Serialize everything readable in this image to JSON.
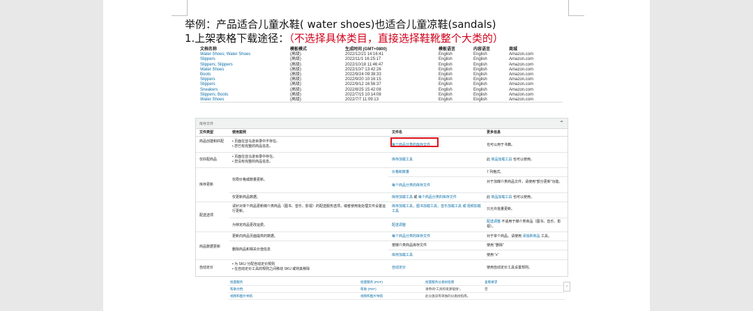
{
  "heading": {
    "line1": "举例：产品适合儿童水鞋( water shoes)也适合儿童凉鞋(sandals)",
    "line2_prefix": "1.上架表格下载途径：",
    "line2_note": "（不选择具体类目，直接选择鞋靴整个大类的）"
  },
  "downloads": {
    "headers": [
      "文档名称",
      "模板模式",
      "生成时间 (GMT+0800)",
      "模板语言",
      "内容语言",
      "商城"
    ],
    "rows": [
      [
        "Water Shoes; Water Shoes",
        "(高级)",
        "2022/12/21 14:16:41",
        "English",
        "English",
        "Amazon.com"
      ],
      [
        "Slippers",
        "(高级)",
        "2022/11/1 16:25:17",
        "English",
        "English",
        "Amazon.com"
      ],
      [
        "Slippers; Slippers",
        "(高级)",
        "2022/10/18 11:46:47",
        "English",
        "English",
        "Amazon.com"
      ],
      [
        "Water Shoes",
        "(高级)",
        "2022/10/7 13:42:26",
        "English",
        "English",
        "Amazon.com"
      ],
      [
        "Boots",
        "(高级)",
        "2022/9/24 09:38:33",
        "English",
        "English",
        "Amazon.com"
      ],
      [
        "Slippers",
        "(高级)",
        "2022/9/20 10:16:15",
        "English",
        "English",
        "Amazon.com"
      ],
      [
        "Slippers",
        "(高级)",
        "2022/9/12 16:56:37",
        "English",
        "English",
        "Amazon.com"
      ],
      [
        "Sneakers",
        "(高级)",
        "2022/8/25 15:42:08",
        "English",
        "English",
        "Amazon.com"
      ],
      [
        "Slippers; Boots",
        "(高级)",
        "2022/7/15 10:14:08",
        "English",
        "English",
        "Amazon.com"
      ],
      [
        "Water Shoes",
        "(高级)",
        "2022/7/7 11:09:13",
        "English",
        "English",
        "Amazon.com"
      ]
    ]
  },
  "usage": {
    "band_title": "库存文件",
    "headers": [
      "文件类型",
      "使用案例",
      "文件名",
      "更多信息"
    ],
    "c_create": "商品创建和匹配",
    "c_create_u1": "• 页面在亚马逊目录中不存在。",
    "c_create_u2": "• 您已有完整的商品信息。",
    "c_create_f": "每个商品分类的库存文件",
    "c_create_i": "也可以用于书籍。",
    "c_match": "仅匹配商品",
    "c_match_u1": "• 页面在亚马逊目录中存在。",
    "c_match_u2": "• 您没有完整的商品信息。",
    "c_match_f": "库存加载工具",
    "c_match_i_pre": "此",
    "c_match_i_link": "商品加载工具",
    "c_match_i_post": "也可以使用。",
    "c_inv": "库存更新",
    "c_inv_f1": "价格和数量",
    "c_inv_i1": "7 列格式。",
    "c_inv_u1": "仅限价格或数量更新。",
    "c_inv_f2": "每个商品分类的库存文件",
    "c_inv_i2": "对于加媒介类商品文件，请使用“部分更新”功能。",
    "c_inv_u3": "仅更新商品数据。",
    "c_inv_f3a": "库存加载工具",
    "c_inv_f3b": "或",
    "c_inv_f3c": "每个商品分类的库存文件",
    "c_inv_i3_pre": "此",
    "c_inv_i3_link": "商品加载工具",
    "c_inv_i3_post": "也可以使用。",
    "c_ship": "配送选项",
    "c_ship_u1": "请针对单个商品更新媒介类商品（图书、音乐、影视）的配送服务选项，或者使用批处理文件设置运行更新。",
    "c_ship_f1a": "库存加载工具",
    "c_ship_f1b": "，图书加载工具，音乐加载工具 或 视频加载工具",
    "c_ship_i1": "只允许批量更新。",
    "c_ship_u2": "为特定商品更改运费。",
    "c_ship_f2": "配送调整",
    "c_ship_i2a": "配送调整",
    "c_ship_i2b": "不适用于媒介类商品（图书、音乐、影视）。",
    "c_data": "商品数据更新",
    "c_data_u1": "更新向商品页面提供的数据。",
    "c_data_f1": "每个商品分类的库存文件",
    "c_data_i1_pre": "对于单个商品，请使用",
    "c_data_i1_link": "添加新商品",
    "c_data_i1_post": "工具。",
    "c_data_u2": "删除商品和相关价值信息",
    "c_data_f2": "按媒介类商品库存文件",
    "c_data_i2": "使用 “删除”",
    "c_data_f3": "库存加载工具",
    "c_data_i3": "使用 “x”",
    "c_auto": "自动定价",
    "c_auto_u1": "• 为 SKU 分配自动定价规则",
    "c_auto_u2": "• 在自动定价工具的规则之间移动 SKU 或将其移除",
    "c_auto_f": "自动定价",
    "c_auto_i": "使用自动定价工具设置规则。"
  },
  "help": {
    "r1": [
      "批量服务",
      "批量服务 (PDF)",
      "批量服务分类树指南",
      "查看要求"
    ],
    "r2": [
      "帮助文档",
      "帮助 (PDF)",
      "请参阅“工具和资源链接”。",
      "否"
    ],
    "r3": [
      "视频和图片导航",
      "视频和图片导航",
      "此分类没有单独的分类树指南。",
      ""
    ]
  }
}
